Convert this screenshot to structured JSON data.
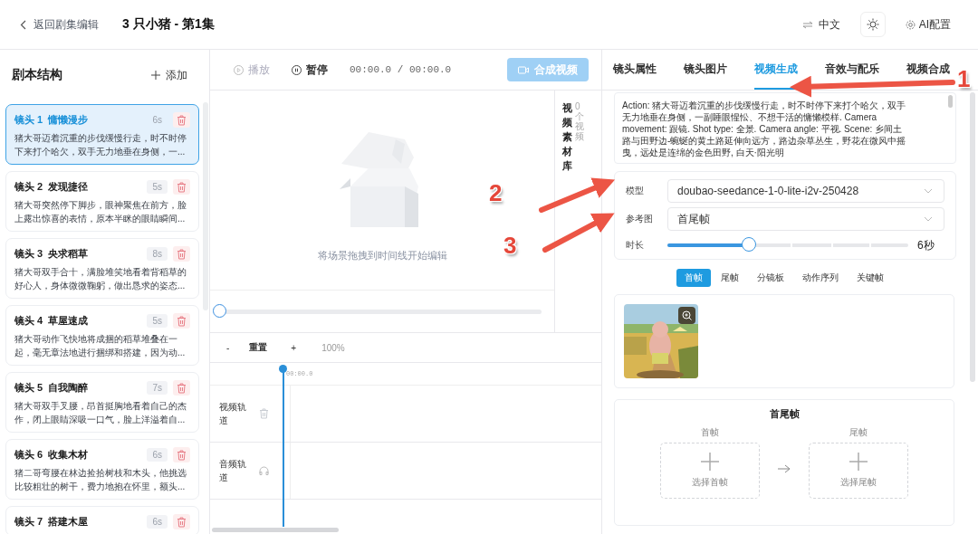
{
  "header": {
    "back": "返回剧集编辑",
    "title": "3 只小猪 - 第1集",
    "language": "中文",
    "ai_config": "AI配置"
  },
  "script": {
    "title": "剧本结构",
    "add": "添加",
    "shots": [
      {
        "label": "镜头 1",
        "name": "慵懒漫步",
        "duration": "6s",
        "desc": "猪大哥迈着沉重的步伐缓慢行走，时不时停下来打个哈欠，双手无力地垂在身侧，一...",
        "selected": true
      },
      {
        "label": "镜头 2",
        "name": "发现捷径",
        "duration": "5s",
        "desc": "猪大哥突然停下脚步，眼神聚焦在前方，脸上露出惊喜的表情，原本半眯的眼睛瞬间...",
        "selected": false
      },
      {
        "label": "镜头 3",
        "name": "央求稻草",
        "duration": "8s",
        "desc": "猪大哥双手合十，满脸堆笑地看着背稻草的好心人，身体微微鞠躬，做出恳求的姿态...",
        "selected": false
      },
      {
        "label": "镜头 4",
        "name": "草屋速成",
        "duration": "5s",
        "desc": "猪大哥动作飞快地将成捆的稻草堆叠在一起，毫无章法地进行捆绑和搭建，因为动...",
        "selected": false
      },
      {
        "label": "镜头 5",
        "name": "自我陶醉",
        "duration": "7s",
        "desc": "猪大哥双手叉腰，昂首挺胸地看着自己的杰作，闭上眼睛深吸一口气，脸上洋溢着自...",
        "selected": false
      },
      {
        "label": "镜头 6",
        "name": "收集木材",
        "duration": "6s",
        "desc": "猪二哥弯腰在林边捡拾树枝和木头，他挑选比较粗壮的树干，费力地抱在怀里，额头...",
        "selected": false
      },
      {
        "label": "镜头 7",
        "name": "搭建木屋",
        "duration": "6s",
        "selected": false
      }
    ]
  },
  "player": {
    "play": "播放",
    "pause": "暂停",
    "time": "00:00.0 / 00:00.0",
    "compose": "合成视频",
    "empty_hint": "将场景拖拽到时间线开始编辑"
  },
  "library": {
    "title": "视频素材库",
    "count": "0个视频"
  },
  "timeline": {
    "zoom_out": "-",
    "reset": "重置",
    "zoom_in": "+",
    "zoom": "100%",
    "ruler": "00:00.0",
    "tracks": [
      {
        "name": "视频轨道",
        "kind": "video"
      },
      {
        "name": "音频轨道",
        "kind": "audio"
      }
    ]
  },
  "properties": {
    "tabs": [
      {
        "label": "镜头属性",
        "selected": false
      },
      {
        "label": "镜头图片",
        "selected": false
      },
      {
        "label": "视频生成",
        "selected": true
      },
      {
        "label": "音效与配乐",
        "selected": false
      },
      {
        "label": "视频合成",
        "selected": false
      }
    ],
    "prompt": "Action: 猪大哥迈着沉重的步伐缓慢行走，时不时停下来打个哈欠，双手无力地垂在身侧，一副睡眼惺忪、不想干活的慵懒模样. Camera movement: 跟镜. Shot type: 全景. Camera angle: 平视. Scene: 乡间土路与田野边-蜿蜒的黄土路延伸向远方，路边杂草丛生，野花在微风中摇曳，远处是连绵的金色田野, 白天·阳光明",
    "model_label": "模型",
    "model": "doubao-seedance-1-0-lite-i2v-250428",
    "ref_label": "参考图",
    "ref": "首尾帧",
    "duration_label": "时长",
    "duration": {
      "level": 0.34,
      "reading": "6秒"
    },
    "image_tabs": [
      {
        "label": "首帧",
        "selected": true
      },
      {
        "label": "尾帧",
        "selected": false
      },
      {
        "label": "分镜板",
        "selected": false
      },
      {
        "label": "动作序列",
        "selected": false
      },
      {
        "label": "关键帧",
        "selected": false
      }
    ],
    "first_last": {
      "title": "首尾帧",
      "first_label": "首帧",
      "first_action": "选择首帧",
      "last_label": "尾帧",
      "last_action": "选择尾帧"
    }
  },
  "annotations": [
    {
      "label": "1"
    },
    {
      "label": "2"
    },
    {
      "label": "3"
    }
  ]
}
